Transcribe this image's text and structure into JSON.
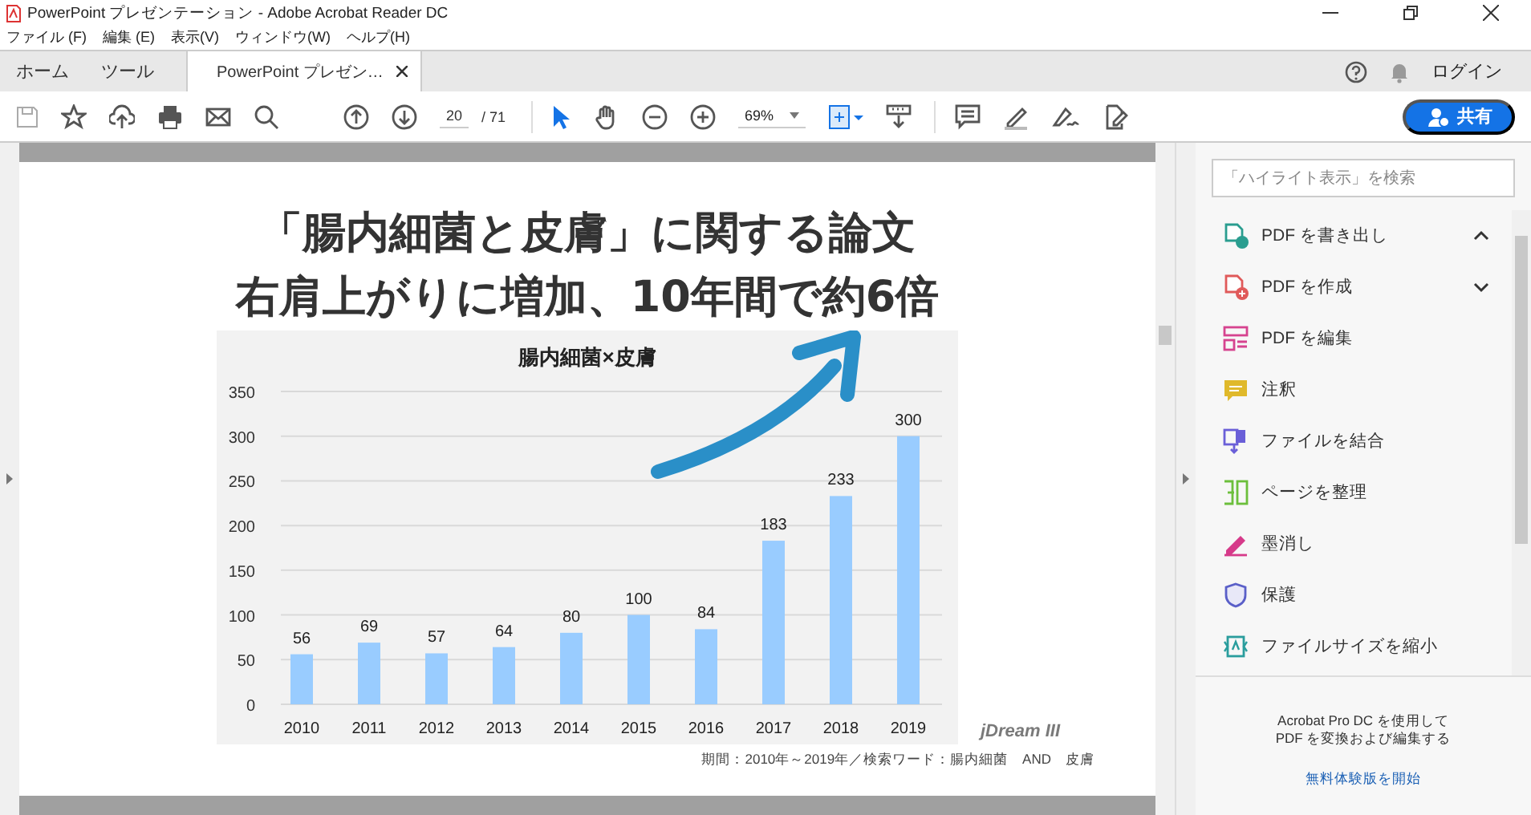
{
  "window": {
    "title": "PowerPoint プレゼンテーション - Adobe Acrobat Reader DC"
  },
  "menu": [
    "ファイル (F)",
    "編集 (E)",
    "表示(V)",
    "ウィンドウ(W)",
    "ヘルプ(H)"
  ],
  "tabs": [
    {
      "label": "ホーム",
      "selected": false
    },
    {
      "label": "ツール",
      "selected": false
    },
    {
      "label": "PowerPoint プレゼン…",
      "selected": true
    }
  ],
  "account": {
    "login": "ログイン"
  },
  "toolbar": {
    "page": "20",
    "page_count": "/ 71",
    "zoom": "69%",
    "share": "共有"
  },
  "document": {
    "headline": [
      "「腸内細菌と皮膚」に関する論文",
      "右肩上がりに増加、10年間で約6倍"
    ],
    "chart_data": {
      "type": "bar",
      "title": "腸内細菌×皮膚",
      "categories": [
        "2010",
        "2011",
        "2012",
        "2013",
        "2014",
        "2015",
        "2016",
        "2017",
        "2018",
        "2019"
      ],
      "series": [
        {
          "color": "#99ccff",
          "values": [
            56,
            69,
            57,
            64,
            80,
            100,
            84,
            183,
            233,
            300
          ]
        }
      ],
      "ylim": [
        0,
        350
      ],
      "yticks": [
        0,
        50,
        100,
        150,
        200,
        250,
        300,
        350
      ],
      "data_labels": true,
      "grid": true
    },
    "logo": "jDream III",
    "caption": "期間：2010年～2019年／検索ワード：腸内細菌　AND　皮膚"
  },
  "tools_pane": {
    "search": {
      "placeholder": "「ハイライト表示」を検索"
    },
    "tools": [
      {
        "label": "PDF を書き出し",
        "expanded": true
      },
      {
        "label": "PDF を作成",
        "expanded": false
      },
      {
        "label": "PDF を編集"
      },
      {
        "label": "注釈"
      },
      {
        "label": "ファイルを結合"
      },
      {
        "label": "ページを整理"
      },
      {
        "label": "墨消し"
      },
      {
        "label": "保護"
      },
      {
        "label": "ファイルサイズを縮小"
      }
    ],
    "promo": "Acrobat Pro DC を使用して\nPDF を変換および編集する",
    "trial_link": "無料体験版を開始"
  }
}
